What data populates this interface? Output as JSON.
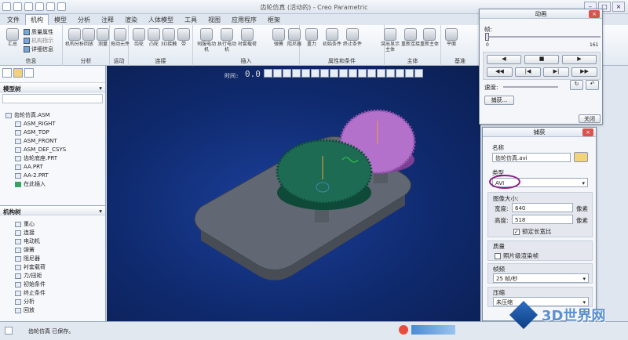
{
  "window": {
    "title": "齿轮仿真 (活动的) - Creo Parametric"
  },
  "tabs": [
    "文件",
    "机构",
    "模型",
    "分析",
    "注释",
    "渲染",
    "人体模型",
    "工具",
    "视图",
    "应用程序",
    "框架"
  ],
  "ribbon": {
    "groups": [
      {
        "label": "信息",
        "tools": [
          "汇总"
        ],
        "small": [
          "质量属性",
          "机构指示",
          "详细信息"
        ]
      },
      {
        "label": "分析",
        "tools": [
          "机构分析",
          "回放",
          "测量"
        ]
      },
      {
        "label": "运动",
        "tools": [
          "拖动元件"
        ]
      },
      {
        "label": "连接",
        "tools": [
          "齿轮",
          "凸轮",
          "3D接触",
          "带"
        ]
      },
      {
        "label": "插入",
        "tools": [
          "伺服电动机",
          "执行电动机",
          "衬套载荷"
        ]
      },
      {
        "label": "属性和条件",
        "tools": [
          "弹簧",
          "阻尼器",
          "重力",
          "初始条件",
          "终止条件"
        ]
      },
      {
        "label": "主体",
        "tools": [
          "突出显示主体",
          "重新连接",
          "重新主体"
        ]
      },
      {
        "label": "基准",
        "tools": [
          "平面"
        ]
      }
    ]
  },
  "model_tree": {
    "title": "模型树",
    "items": [
      "齿轮仿真.ASM",
      "ASM_RIGHT",
      "ASM_TOP",
      "ASM_FRONT",
      "ASM_DEF_CSYS",
      "齿轮底座.PRT",
      "AA.PRT",
      "AA-2.PRT",
      "在此插入"
    ]
  },
  "mech_tree": {
    "title": "机构树",
    "items": [
      "重心",
      "连接",
      "电动机",
      "弹簧",
      "阻尼器",
      "衬套载荷",
      "力/扭矩",
      "初始条件",
      "终止条件",
      "分析",
      "回放"
    ]
  },
  "viewport": {
    "time_label": "时间:",
    "time_value": "0.0"
  },
  "animation_dialog": {
    "title": "动画",
    "frame_label": "帧:",
    "slider_start": "0",
    "slider_end": "161",
    "speed_label": "速度:",
    "capture_button": "捕获...",
    "close_button": "关闭"
  },
  "capture_dialog": {
    "title": "捕获",
    "name_label": "名称",
    "name_value": "齿轮仿真.avi",
    "type_label": "类型",
    "type_value": "AVI",
    "size_label": "图像大小:",
    "width_label": "宽度:",
    "width_value": "640",
    "height_label": "高度:",
    "height_value": "518",
    "unit": "像素",
    "lock_label": "锁定长宽比",
    "quality_label": "质量",
    "photo_label": "照片级渲染帧",
    "fps_label": "帧频",
    "fps_value": "25 帧/秒",
    "compress_label": "压缩",
    "compress_value": "未压缩"
  },
  "status": {
    "message": "齿轮仿真 已保存。"
  },
  "watermark": "3D世界网"
}
